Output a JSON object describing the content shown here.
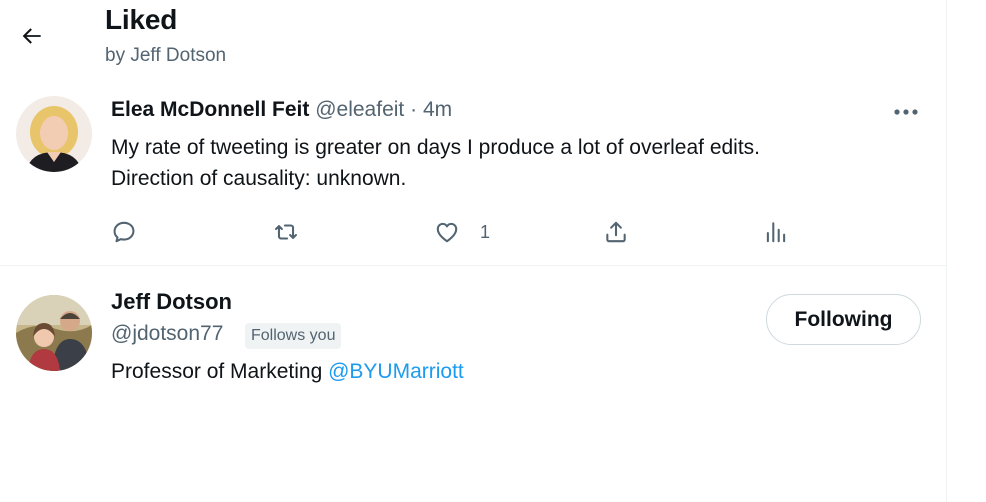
{
  "header": {
    "title": "Liked",
    "subtitle": "by Jeff Dotson",
    "back_icon": "arrow-left-icon"
  },
  "tweet": {
    "author_name": "Elea McDonnell Feit",
    "author_handle": "@eleafeit",
    "separator": "·",
    "time": "4m",
    "text_line1": "My rate of tweeting is greater on days I produce a lot of overleaf edits.",
    "text_line2": "Direction of causality: unknown.",
    "actions": {
      "reply_icon": "reply-icon",
      "retweet_icon": "retweet-icon",
      "like_icon": "heart-icon",
      "like_count": "1",
      "share_icon": "share-icon",
      "analytics_icon": "analytics-icon"
    },
    "more_icon": "more-icon"
  },
  "profile": {
    "name": "Jeff Dotson",
    "handle": "@jdotson77",
    "follows_you": "Follows you",
    "follow_button": "Following",
    "bio_text": "Professor of Marketing ",
    "bio_mention": "@BYUMarriott"
  },
  "colors": {
    "text_primary": "#0f1419",
    "text_secondary": "#536471",
    "link": "#1d9bf0",
    "border": "#eff3f4"
  }
}
